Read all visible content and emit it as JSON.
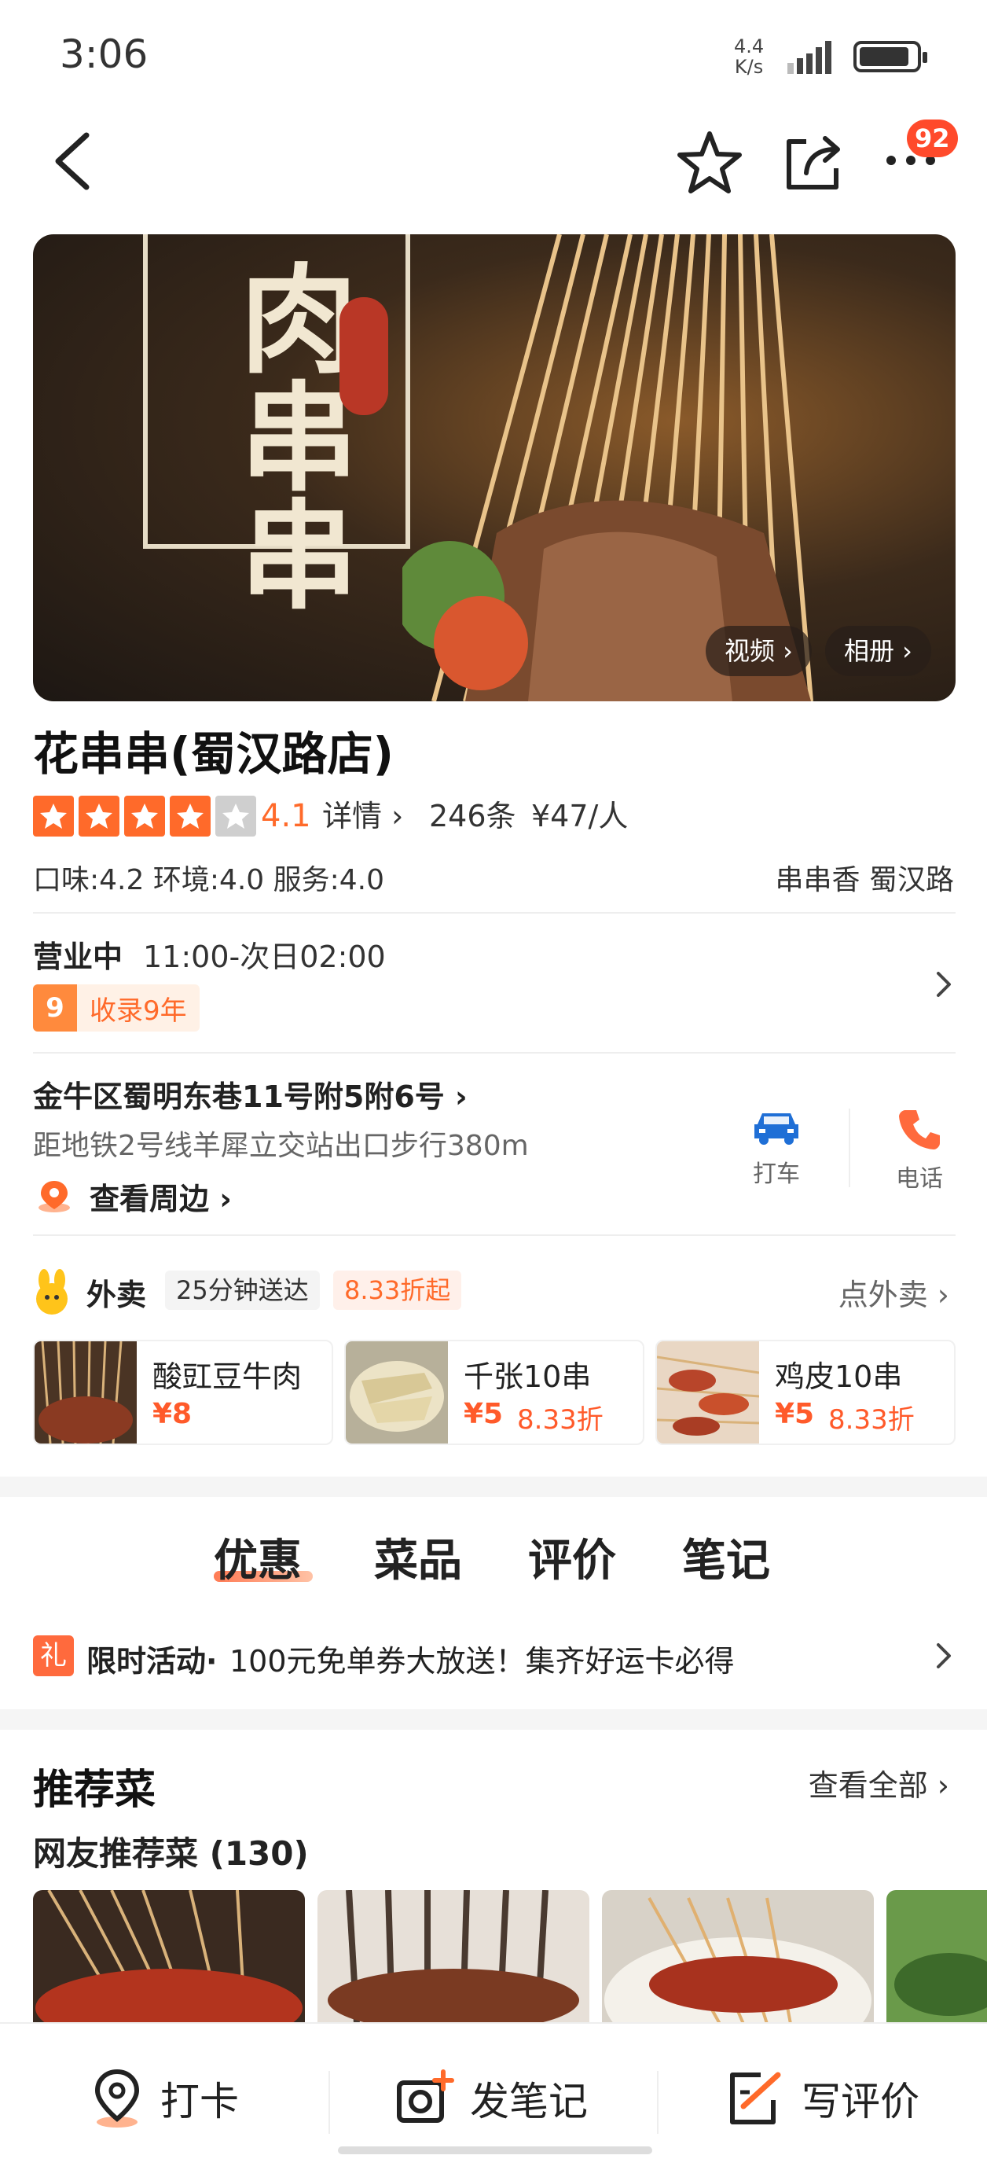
{
  "status_bar": {
    "time": "3:06",
    "net_speed_value": "4.4",
    "net_speed_unit": "K/s"
  },
  "nav": {
    "badge_count": "92"
  },
  "hero": {
    "sign_text": "肉串串",
    "video_label": "视频 ›",
    "album_label": "相册 ›"
  },
  "shop": {
    "name": "花串串(蜀汉路店)",
    "stars": 4,
    "rating": "4.1",
    "detail_label": "详情 ›",
    "review_count": "246条",
    "price_per_person": "¥47/人",
    "scores": "口味:4.2  环境:4.0  服务:4.0",
    "tags": "串串香  蜀汉路"
  },
  "hours": {
    "status": "营业中",
    "time": "11:00-次日02:00",
    "years_num": "9",
    "years_text": "收录9年"
  },
  "location": {
    "address": "金牛区蜀明东巷11号附5附6号 ›",
    "metro": "距地铁2号线羊犀立交站出口步行380m",
    "nearby": "查看周边 ›",
    "taxi_label": "打车",
    "phone_label": "电话"
  },
  "takeout": {
    "title": "外卖",
    "delivery_time": "25分钟送达",
    "discount": "8.33折起",
    "link": "点外卖 ›",
    "dishes": [
      {
        "name": "酸豇豆牛肉",
        "price": "¥8",
        "discount": ""
      },
      {
        "name": "千张10串",
        "price": "¥5",
        "discount": "8.33折"
      },
      {
        "name": "鸡皮10串",
        "price": "¥5",
        "discount": "8.33折"
      }
    ]
  },
  "tabs": [
    "优惠",
    "菜品",
    "评价",
    "笔记"
  ],
  "promo": {
    "icon": "礼",
    "title": "限时活动·",
    "text": "100元免单券大放送！集齐好运卡必得"
  },
  "recommend": {
    "title": "推荐菜",
    "view_all": "查看全部 ›",
    "subtitle": "网友推荐菜 (130)"
  },
  "bottom_bar": {
    "checkin": "打卡",
    "post_note": "发笔记",
    "write_review": "写评价"
  },
  "colors": {
    "accent": "#ff6a2a",
    "star_empty": "#cfcfcf",
    "taxi_blue": "#1f6fd6",
    "phone_orange": "#ff6a3d"
  }
}
